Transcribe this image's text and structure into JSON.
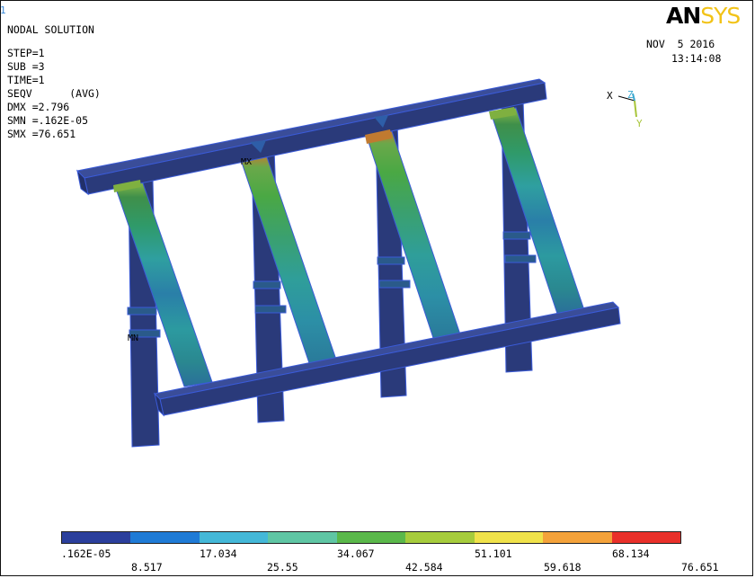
{
  "window_number": "1",
  "title_lines": [
    "NODAL SOLUTION",
    "",
    "STEP=1",
    "SUB =3",
    "TIME=1",
    "SEQV      (AVG)",
    "DMX =2.796",
    "SMN =.162E-05",
    "SMX =76.651"
  ],
  "logo": {
    "an": "AN",
    "sys": "SYS"
  },
  "date": "NOV  5 2016",
  "time": "13:14:08",
  "triad": {
    "x": "X",
    "y": "Y",
    "z": "Z"
  },
  "markers": {
    "mx": "MX",
    "mn": "MN"
  },
  "legend": {
    "colors": [
      "#2b3f9c",
      "#1f7bd6",
      "#44b8d8",
      "#5fc6a4",
      "#5ab84a",
      "#a6cc3c",
      "#f0e24a",
      "#f4a23a",
      "#e9302a"
    ],
    "labels_top": [
      ".162E-05",
      "17.034",
      "34.067",
      "51.101",
      "68.134"
    ],
    "labels_bottom": [
      "8.517",
      "25.55",
      "42.584",
      "59.618",
      "76.651"
    ]
  },
  "colors": {
    "structure": "#2a3a7a",
    "structure_edge": "#3b5bd8"
  }
}
